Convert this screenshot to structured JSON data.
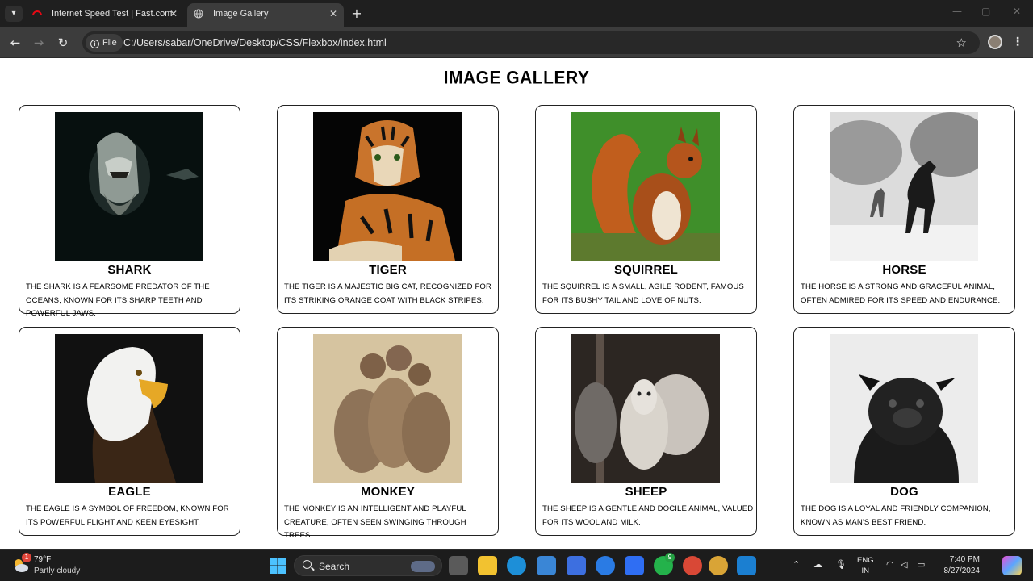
{
  "browser": {
    "tabs": [
      {
        "title": "Internet Speed Test | Fast.com",
        "active": false
      },
      {
        "title": "Image Gallery",
        "active": true
      }
    ],
    "url_scheme_label": "File",
    "url": "C:/Users/sabar/OneDrive/Desktop/CSS/Flexbox/index.html"
  },
  "page": {
    "title": "Image Gallery",
    "cards": [
      {
        "name": "Shark",
        "description": "The shark is a fearsome predator of the oceans, known for its sharp teeth and powerful jaws."
      },
      {
        "name": "Tiger",
        "description": "The tiger is a majestic big cat, recognized for its striking orange coat with black stripes."
      },
      {
        "name": "Squirrel",
        "description": "The squirrel is a small, agile rodent, famous for its bushy tail and love of nuts."
      },
      {
        "name": "Horse",
        "description": "The horse is a strong and graceful animal, often admired for its speed and endurance."
      },
      {
        "name": "Eagle",
        "description": "The eagle is a symbol of freedom, known for its powerful flight and keen eyesight."
      },
      {
        "name": "Monkey",
        "description": "The monkey is an intelligent and playful creature, often seen swinging through trees."
      },
      {
        "name": "Sheep",
        "description": "The sheep is a gentle and docile animal, valued for its wool and milk."
      },
      {
        "name": "Dog",
        "description": "The dog is a loyal and friendly companion, known as man's best friend."
      }
    ]
  },
  "taskbar": {
    "weather_temp": "79°F",
    "weather_desc": "Partly cloudy",
    "weather_badge": "1",
    "search_label": "Search",
    "whatsapp_badge": "9",
    "lang_line1": "ENG",
    "lang_line2": "IN",
    "time": "7:40 PM",
    "date": "8/27/2024"
  },
  "colors": {
    "chrome_dark": "#1f1f1f",
    "chrome_toolbar": "#3c3c3c",
    "page_bg": "#ffffff",
    "card_border": "#222222",
    "taskbar_bg": "#1c1c1c"
  }
}
